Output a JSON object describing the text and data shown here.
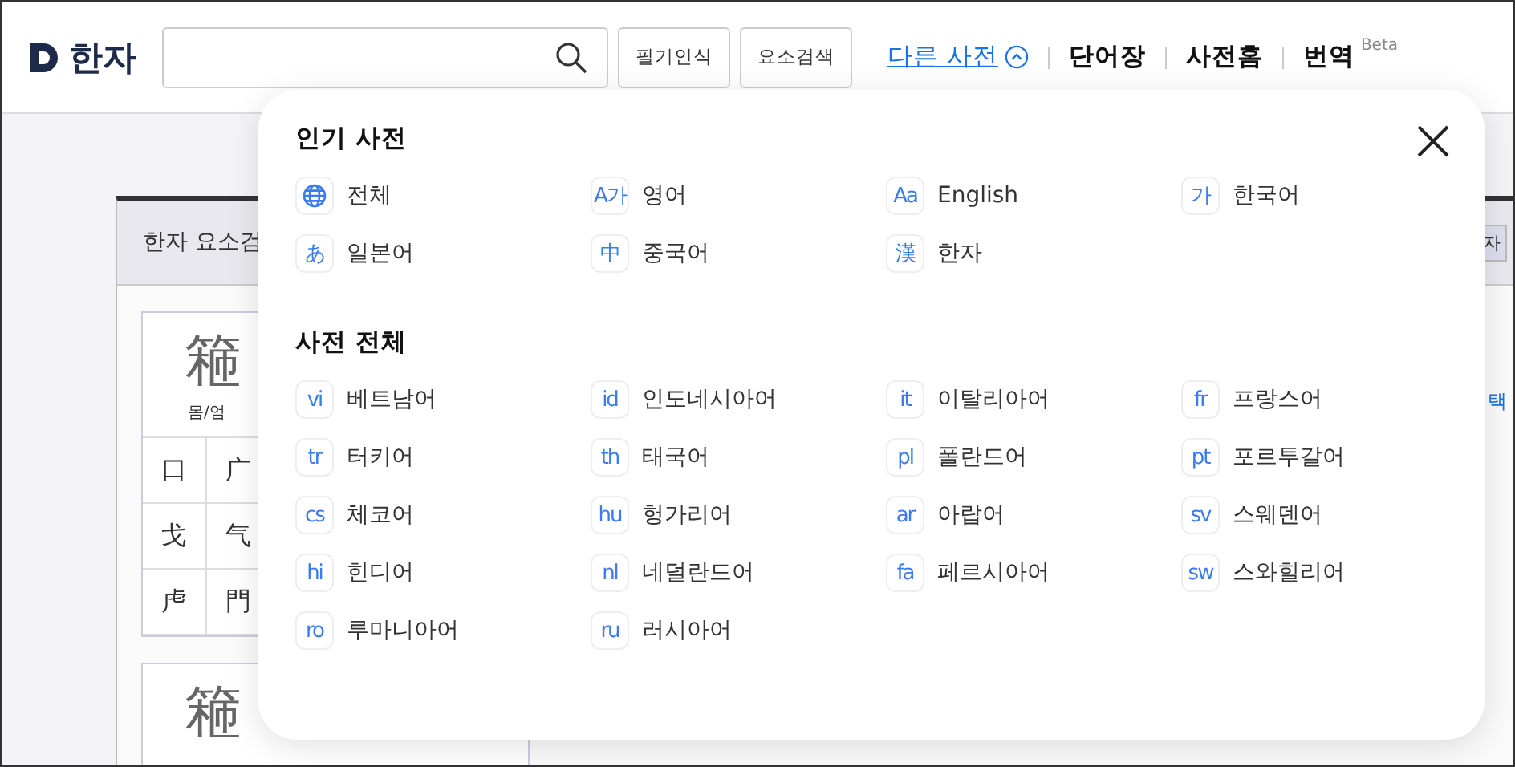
{
  "header": {
    "logo": "한자",
    "buttons": [
      "필기인식",
      "요소검색"
    ],
    "nav": [
      {
        "label": "다른 사전",
        "kind": "dropdown",
        "expanded": true
      },
      {
        "label": "단어장",
        "kind": "link"
      },
      {
        "label": "사전홈",
        "kind": "link"
      },
      {
        "label": "번역",
        "kind": "link",
        "badge": "Beta"
      }
    ]
  },
  "background": {
    "panel_title": "한자 요소검",
    "side_tab": "자",
    "side_text": "택",
    "cards": [
      {
        "character": "篐",
        "label": "몸/엄",
        "cells": [
          "口",
          "广",
          "戈",
          "气",
          "虍",
          "門"
        ]
      },
      {
        "character": "篐"
      }
    ]
  },
  "popup": {
    "sections": [
      {
        "title": "인기 사전",
        "items": [
          {
            "kind": "globe",
            "label": "전체"
          },
          {
            "badge": "A가",
            "label": "영어"
          },
          {
            "badge": "Aa",
            "label": "English"
          },
          {
            "badge": "가",
            "label": "한국어"
          },
          {
            "badge": "あ",
            "label": "일본어"
          },
          {
            "badge": "中",
            "label": "중국어"
          },
          {
            "badge": "漢",
            "label": "한자"
          }
        ]
      },
      {
        "title": "사전 전체",
        "items": [
          {
            "badge": "vi",
            "label": "베트남어"
          },
          {
            "badge": "id",
            "label": "인도네시아어"
          },
          {
            "badge": "it",
            "label": "이탈리아어"
          },
          {
            "badge": "fr",
            "label": "프랑스어"
          },
          {
            "badge": "tr",
            "label": "터키어"
          },
          {
            "badge": "th",
            "label": "태국어"
          },
          {
            "badge": "pl",
            "label": "폴란드어"
          },
          {
            "badge": "pt",
            "label": "포르투갈어"
          },
          {
            "badge": "cs",
            "label": "체코어"
          },
          {
            "badge": "hu",
            "label": "헝가리어"
          },
          {
            "badge": "ar",
            "label": "아랍어"
          },
          {
            "badge": "sv",
            "label": "스웨덴어"
          },
          {
            "badge": "hi",
            "label": "힌디어"
          },
          {
            "badge": "nl",
            "label": "네덜란드어"
          },
          {
            "badge": "fa",
            "label": "페르시아어"
          },
          {
            "badge": "sw",
            "label": "스와힐리어"
          },
          {
            "badge": "ro",
            "label": "루마니아어"
          },
          {
            "badge": "ru",
            "label": "러시아어"
          }
        ]
      }
    ]
  }
}
